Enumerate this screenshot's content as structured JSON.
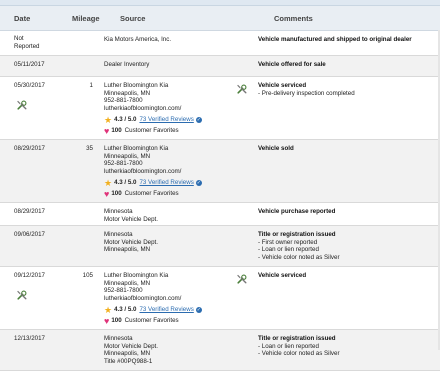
{
  "table": {
    "headers": {
      "date": "Date",
      "mileage": "Mileage",
      "source": "Source",
      "comments": "Comments"
    },
    "rows": [
      {
        "date": "Not Reported",
        "mileage": "",
        "source": [
          "Kia Motors America, Inc."
        ],
        "comments_title": "Vehicle manufactured and shipped to original dealer",
        "comments_items": []
      },
      {
        "date": "05/11/2017",
        "mileage": "",
        "source": [
          "Dealer Inventory"
        ],
        "comments_title": "Vehicle offered for sale",
        "comments_items": []
      },
      {
        "date": "05/30/2017",
        "mileage": "1",
        "source": [
          "Luther Bloomington Kia",
          "Minneapolis, MN",
          "952-881-7800",
          "lutherkiaofbloomington.com/"
        ],
        "rating": "4.3 / 5.0",
        "reviews": "73 Verified Reviews",
        "favorites": "100",
        "favorites_label": "Customer Favorites",
        "comments_title": "Vehicle serviced",
        "comments_items": [
          "- Pre-delivery inspection completed"
        ],
        "service_icon": "wrench-icon"
      },
      {
        "date": "08/29/2017",
        "mileage": "35",
        "source": [
          "Luther Bloomington Kia",
          "Minneapolis, MN",
          "952-881-7800",
          "lutherkiaofbloomington.com/"
        ],
        "rating": "4.3 / 5.0",
        "reviews": "73 Verified Reviews",
        "favorites": "100",
        "favorites_label": "Customer Favorites",
        "comments_title": "Vehicle sold",
        "comments_items": []
      },
      {
        "date": "08/29/2017",
        "mileage": "",
        "source": [
          "Minnesota",
          "Motor Vehicle Dept."
        ],
        "comments_title": "Vehicle purchase reported",
        "comments_items": []
      },
      {
        "date": "09/06/2017",
        "mileage": "",
        "source": [
          "Minnesota",
          "Motor Vehicle Dept.",
          "Minneapolis, MN"
        ],
        "comments_title": "Title or registration issued",
        "comments_items": [
          "- First owner reported",
          "- Loan or lien reported",
          "- Vehicle color noted as Silver"
        ]
      },
      {
        "date": "09/12/2017",
        "mileage": "105",
        "source": [
          "Luther Bloomington Kia",
          "Minneapolis, MN",
          "952-881-7800",
          "lutherkiaofbloomington.com/"
        ],
        "rating": "4.3 / 5.0",
        "reviews": "73 Verified Reviews",
        "favorites": "100",
        "favorites_label": "Customer Favorites",
        "comments_title": "Vehicle serviced",
        "comments_items": [],
        "service_icon": "wrench-icon"
      },
      {
        "date": "12/13/2017",
        "mileage": "",
        "source": [
          "Minnesota",
          "Motor Vehicle Dept.",
          "Minneapolis, MN",
          "Title #00PQ988-1"
        ],
        "comments_title": "Title or registration issued",
        "comments_items": [
          "- Loan or lien reported",
          "- Vehicle color noted as Silver"
        ]
      }
    ]
  },
  "colors": {
    "header_bg": "#e9eef3",
    "alt_row": "#f2f2f2",
    "link": "#2b6cb0",
    "star": "#f2b01e",
    "heart": "#e0337a"
  }
}
